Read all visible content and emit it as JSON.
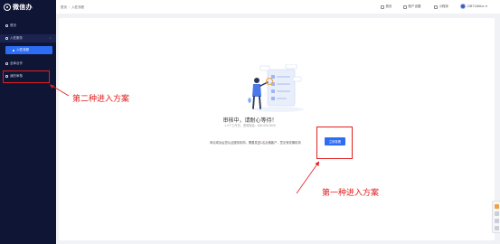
{
  "app": {
    "logo_text": "微信办"
  },
  "sidebar": {
    "items": [
      {
        "label": "首页",
        "icon": "home-icon"
      },
      {
        "label": "入驻服务",
        "icon": "grid-icon"
      },
      {
        "label": "入驻流程",
        "icon": "dot-icon"
      },
      {
        "label": "全库合作",
        "icon": "stack-icon"
      },
      {
        "label": "我的审核",
        "icon": "audit-icon"
      }
    ]
  },
  "header": {
    "breadcrumb": [
      "首页",
      "入驻流程"
    ],
    "actions": [
      {
        "label": "首页",
        "icon": "home-icon"
      },
      {
        "label": "账户设置",
        "icon": "settings-icon"
      },
      {
        "label": "小程序",
        "icon": "miniapp-icon"
      }
    ],
    "user_name": "13871466xx"
  },
  "main": {
    "status_title": "审核中，请耐心等待！",
    "status_sub": "1-3个工作日，咨询电话：400-000-0000",
    "desc_before": "申请成功后您认证服务机构，需要发送",
    "desc_highlight": "1",
    "desc_after": "名合格客户，意见有效期机构",
    "button_label": "立即查看"
  },
  "annotations": {
    "second": "第二种进入方案",
    "first": "第一种进入方案"
  },
  "colors": {
    "sidebar_bg": "#0f1535",
    "primary": "#2d6cf4",
    "annotation_red": "#e02020"
  }
}
